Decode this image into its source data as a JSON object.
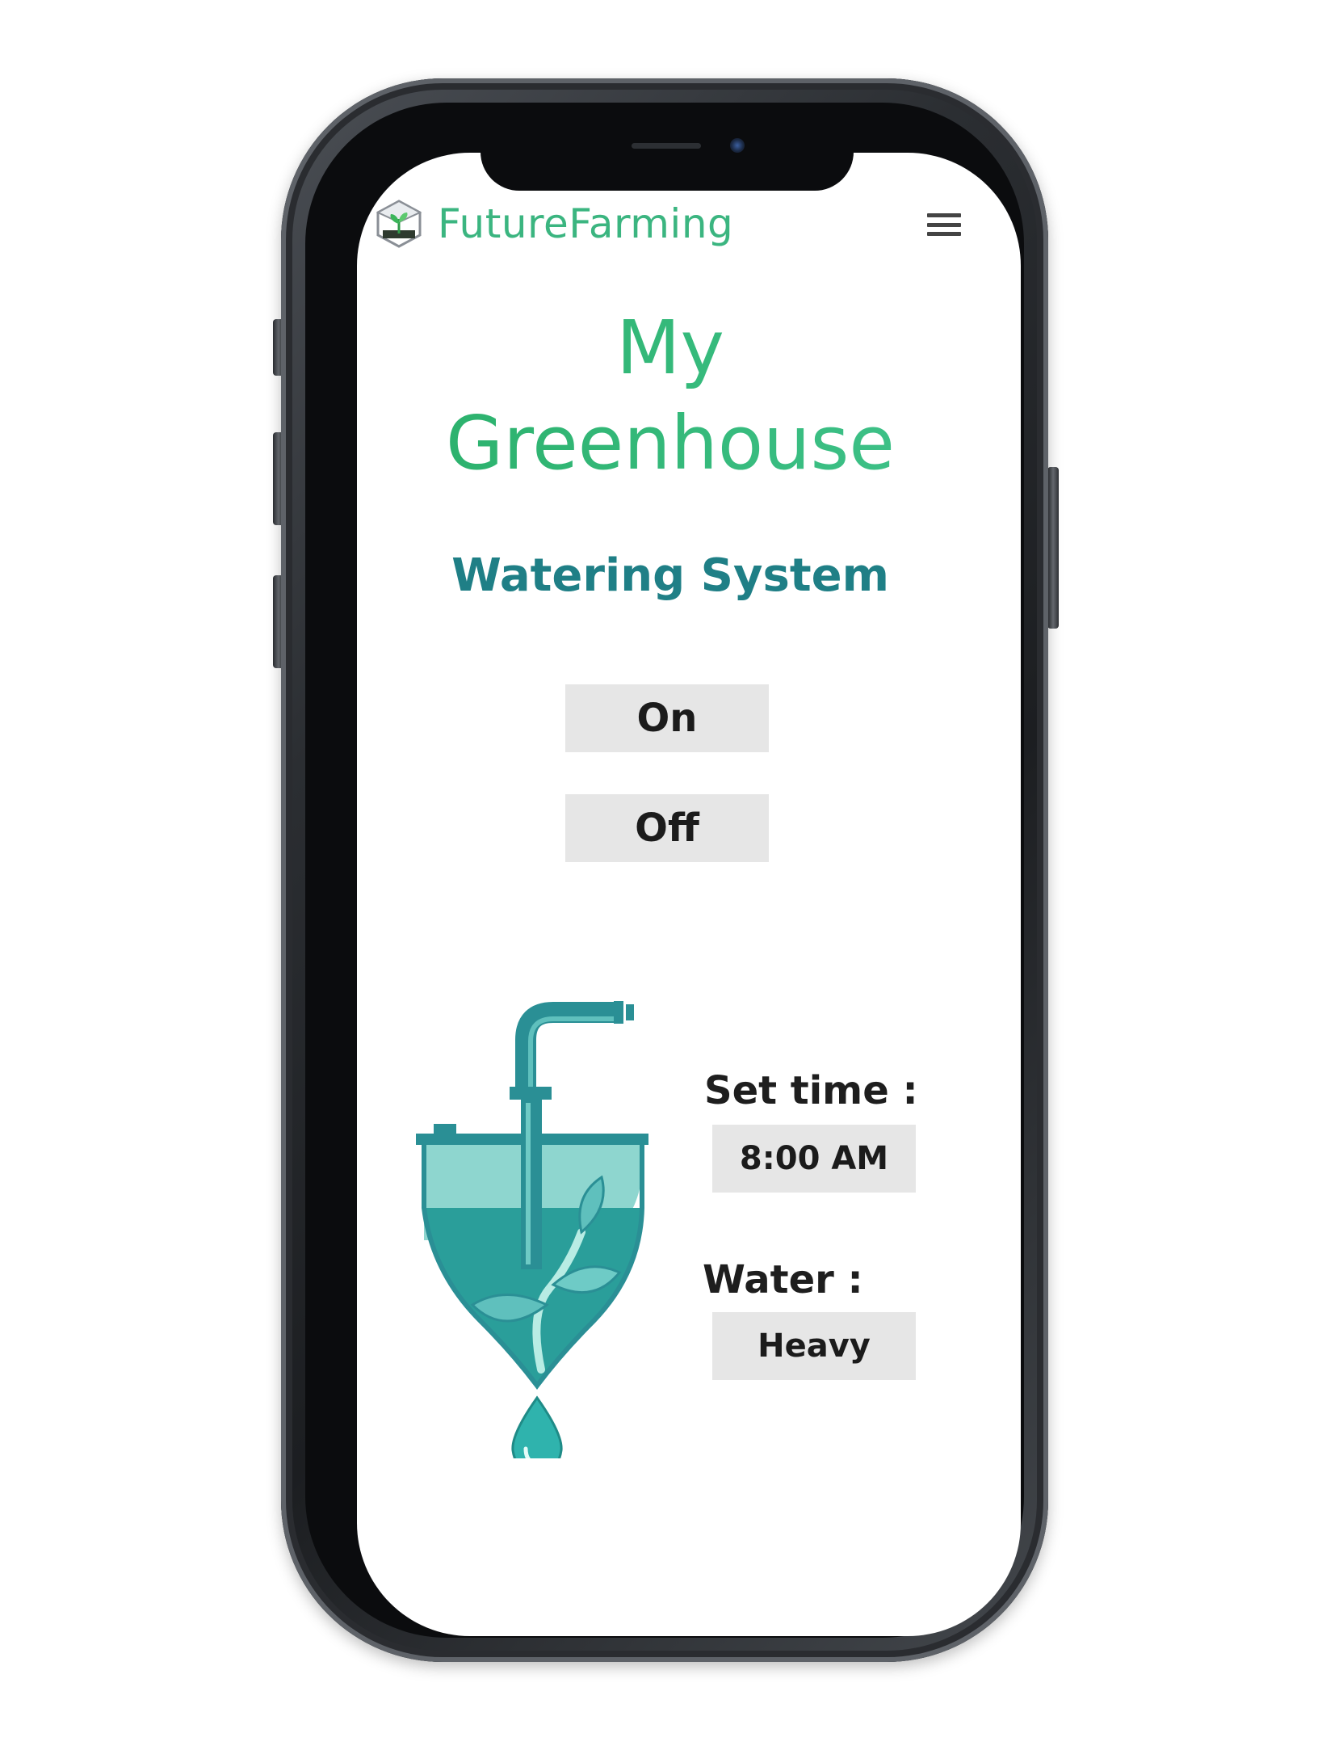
{
  "header": {
    "brand": "FutureFarming",
    "logo_icon": "greenhouse-seedling-icon",
    "menu_icon": "hamburger-menu-icon"
  },
  "page": {
    "title_line1": "My",
    "title_line2": "Greenhouse",
    "subtitle": "Watering System"
  },
  "controls": {
    "on_label": "On",
    "off_label": "Off"
  },
  "settings": {
    "time_label": "Set time :",
    "time_value": "8:00 AM",
    "water_label": "Water :",
    "water_value": "Heavy"
  },
  "illustration": {
    "icon": "watering-tank-plant-icon"
  },
  "colors": {
    "brand_green": "#3bb580",
    "title_green": "#2fb56f",
    "subtitle_teal": "#1f7f86",
    "button_gray": "#e6e6e6",
    "water_teal": "#2a9e9a"
  }
}
